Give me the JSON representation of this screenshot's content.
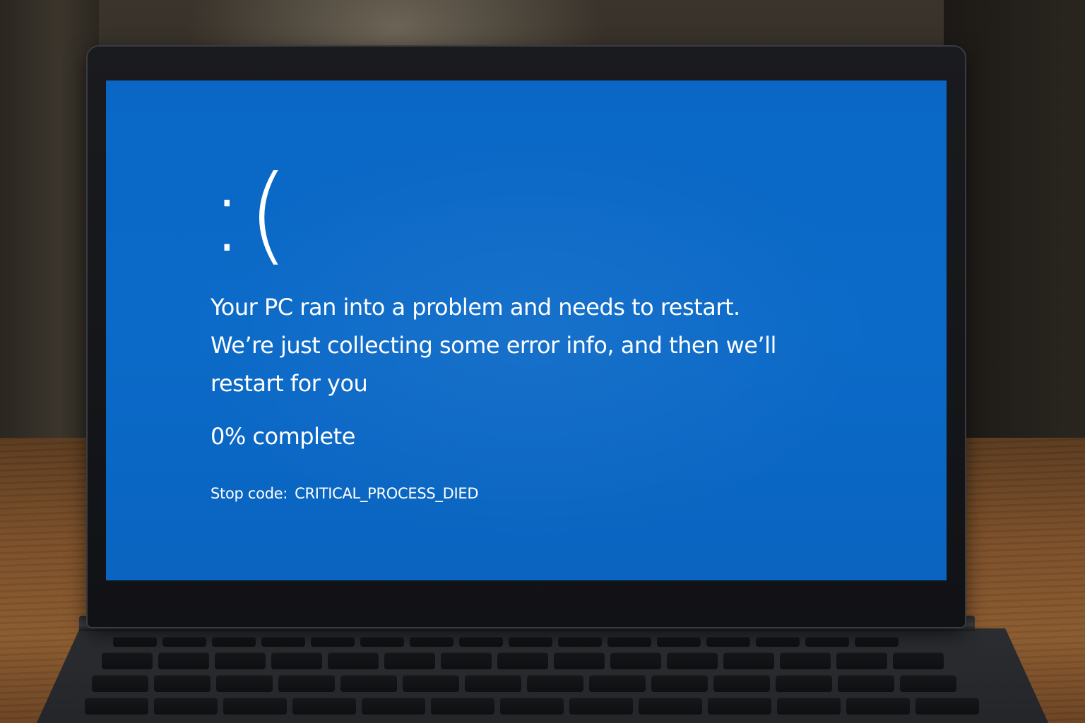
{
  "bsod": {
    "frown": ":(",
    "message_lines": [
      "Your PC ran into a problem and needs to restart.",
      "We’re just collecting some error info, and then we’ll",
      "restart for you"
    ],
    "progress_text": "0% complete",
    "stop_label": "Stop code:",
    "stop_code": "CRITICAL_PROCESS_DIED"
  },
  "colors": {
    "screen_blue": "#0a67c5",
    "text": "#ffffff",
    "bezel": "#111215"
  },
  "progress_fraction": 0
}
